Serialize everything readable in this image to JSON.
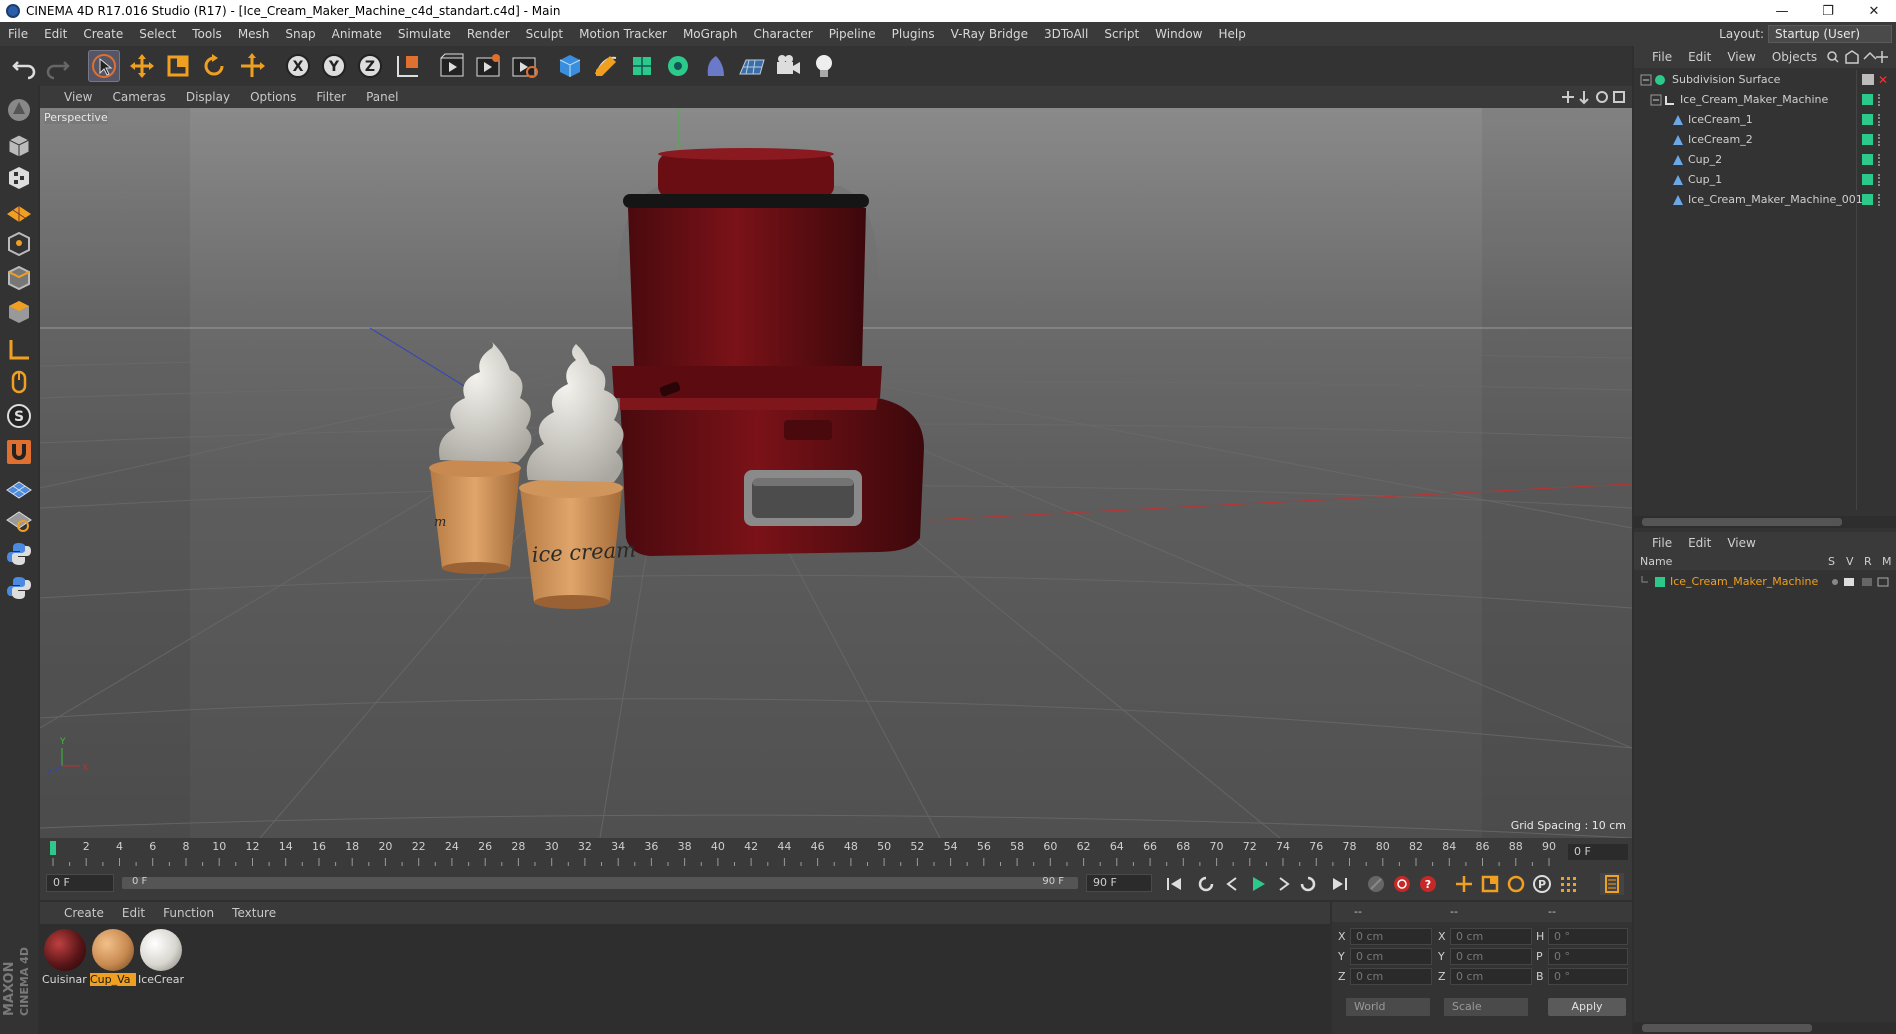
{
  "window": {
    "title": "CINEMA 4D R17.016 Studio (R17) - [Ice_Cream_Maker_Machine_c4d_standart.c4d] - Main",
    "minimize": "—",
    "restore": "❐",
    "close": "✕"
  },
  "menubar": {
    "items": [
      "File",
      "Edit",
      "Create",
      "Select",
      "Tools",
      "Mesh",
      "Snap",
      "Animate",
      "Simulate",
      "Render",
      "Sculpt",
      "Motion Tracker",
      "MoGraph",
      "Character",
      "Pipeline",
      "Plugins",
      "V-Ray Bridge",
      "3DToAll",
      "Script",
      "Window",
      "Help"
    ],
    "layout_label": "Layout:",
    "layout_value": "Startup (User)"
  },
  "toolbar": {
    "icons": [
      "undo-icon",
      "redo-icon",
      "live-select-icon",
      "move-icon",
      "scale-icon",
      "rotate-icon",
      "transform-icon",
      "x-axis-icon",
      "y-axis-icon",
      "z-axis-icon",
      "world-coords-icon",
      "render-view-icon",
      "render-picture-viewer-icon",
      "render-settings-icon",
      "cube-icon",
      "pen-icon",
      "subdivision-icon",
      "cloner-icon",
      "deformer-icon",
      "floor-icon",
      "camera-icon",
      "light-icon"
    ],
    "axis_x": "X",
    "axis_y": "Y",
    "axis_z": "Z"
  },
  "lefttoolbar": {
    "icons": [
      "make-editable-icon",
      "model-mode-icon",
      "texture-mode-icon",
      "workplane-icon",
      "points-mode-icon",
      "edges-mode-icon",
      "polygons-mode-icon",
      "axis-mode-icon",
      "tweak-mode-icon",
      "solo-icon",
      "magnet-icon",
      "snap-grid-icon",
      "snap-settings-icon",
      "python-icon",
      "python-2-icon"
    ],
    "solo_letter": "S",
    "brand_1": "MAXON",
    "brand_2": "CINEMA 4D"
  },
  "viewport": {
    "menu": [
      "View",
      "Cameras",
      "Display",
      "Options",
      "Filter",
      "Panel"
    ],
    "label": "Perspective",
    "grid_spacing": "Grid Spacing : 10 cm",
    "cup_text_front": "ice cream",
    "cup_text_back": "m"
  },
  "timeline": {
    "ticks": [
      "0",
      "2",
      "4",
      "6",
      "8",
      "10",
      "12",
      "14",
      "16",
      "18",
      "20",
      "22",
      "24",
      "26",
      "28",
      "30",
      "32",
      "34",
      "36",
      "38",
      "40",
      "42",
      "44",
      "46",
      "48",
      "50",
      "52",
      "54",
      "56",
      "58",
      "60",
      "62",
      "64",
      "66",
      "68",
      "70",
      "72",
      "74",
      "76",
      "78",
      "80",
      "82",
      "84",
      "86",
      "88",
      "90"
    ],
    "end_frame": "0 F"
  },
  "transport": {
    "current_frame": "0 F",
    "range_start": "0 F",
    "range_end": "90 F",
    "max_frame": "90 F"
  },
  "materials": {
    "menu": [
      "Create",
      "Edit",
      "Function",
      "Texture"
    ],
    "items": [
      {
        "name": "Cuisinar",
        "selected": false,
        "color": "#5a1618"
      },
      {
        "name": "Cup_Va",
        "selected": true,
        "color": "#c88a50"
      },
      {
        "name": "IceCrear",
        "selected": false,
        "color": "#d8d6cf"
      }
    ]
  },
  "coords": {
    "header_left": "--",
    "header_mid": "--",
    "header_right": "--",
    "rows": [
      {
        "l1": "X",
        "v1": "0 cm",
        "l2": "X",
        "v2": "0 cm",
        "l3": "H",
        "v3": "0 °"
      },
      {
        "l1": "Y",
        "v1": "0 cm",
        "l2": "Y",
        "v2": "0 cm",
        "l3": "P",
        "v3": "0 °"
      },
      {
        "l1": "Z",
        "v1": "0 cm",
        "l2": "Z",
        "v2": "0 cm",
        "l3": "B",
        "v3": "0 °"
      }
    ],
    "space": "World",
    "mode": "Scale",
    "apply": "Apply"
  },
  "objects_panel": {
    "menu": [
      "File",
      "Edit",
      "View",
      "Objects"
    ],
    "items": [
      {
        "name": "Subdivision Surface",
        "indent": 0
      },
      {
        "name": "Ice_Cream_Maker_Machine",
        "indent": 1
      },
      {
        "name": "IceCream_1",
        "indent": 2
      },
      {
        "name": "IceCream_2",
        "indent": 2
      },
      {
        "name": "Cup_2",
        "indent": 2
      },
      {
        "name": "Cup_1",
        "indent": 2
      },
      {
        "name": "Ice_Cream_Maker_Machine_001",
        "indent": 2
      }
    ]
  },
  "attributes_panel": {
    "menu": [
      "File",
      "Edit",
      "View"
    ],
    "col_name": "Name",
    "col_s": "S",
    "col_v": "V",
    "col_r": "R",
    "col_m": "M",
    "item": "Ice_Cream_Maker_Machine"
  },
  "colors": {
    "accent_green": "#2dc98a",
    "selection_orange": "#f0a020",
    "machine_red": "#6e0f14"
  }
}
